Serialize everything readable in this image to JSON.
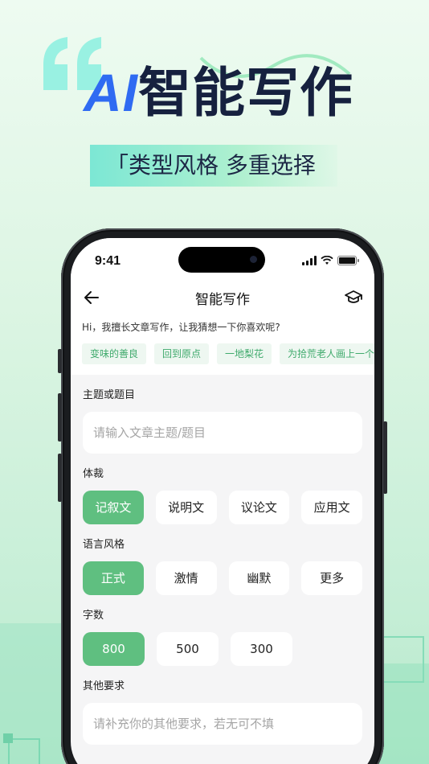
{
  "hero": {
    "title_ai": "AI",
    "title_rest": "智能写作",
    "subtitle": "「类型风格 多重选择"
  },
  "status_bar": {
    "time": "9:41"
  },
  "nav": {
    "back_icon": "arrow-left-icon",
    "title": "智能写作",
    "action_icon": "graduation-cap-icon"
  },
  "greeting": "Hi，我擅长文章写作，让我猜想一下你喜欢呢?",
  "suggestions": [
    "变味的善良",
    "回到原点",
    "一地梨花",
    "为拾荒老人画上一个"
  ],
  "topic": {
    "label": "主题或题目",
    "placeholder": "请输入文章主题/题目"
  },
  "genre": {
    "label": "体裁",
    "options": [
      "记叙文",
      "说明文",
      "议论文",
      "应用文"
    ],
    "selected": "记叙文"
  },
  "style": {
    "label": "语言风格",
    "options": [
      "正式",
      "激情",
      "幽默",
      "更多"
    ],
    "selected": "正式"
  },
  "word_count": {
    "label": "字数",
    "options": [
      "800",
      "500",
      "300"
    ],
    "selected": "800"
  },
  "other": {
    "label": "其他要求",
    "placeholder": "请补充你的其他要求，若无可不填"
  },
  "colors": {
    "accent_green": "#5fbf80",
    "chip_text": "#3faa6c",
    "hero_ai_blue": "#2f6bf2",
    "hero_text": "#16213f"
  }
}
